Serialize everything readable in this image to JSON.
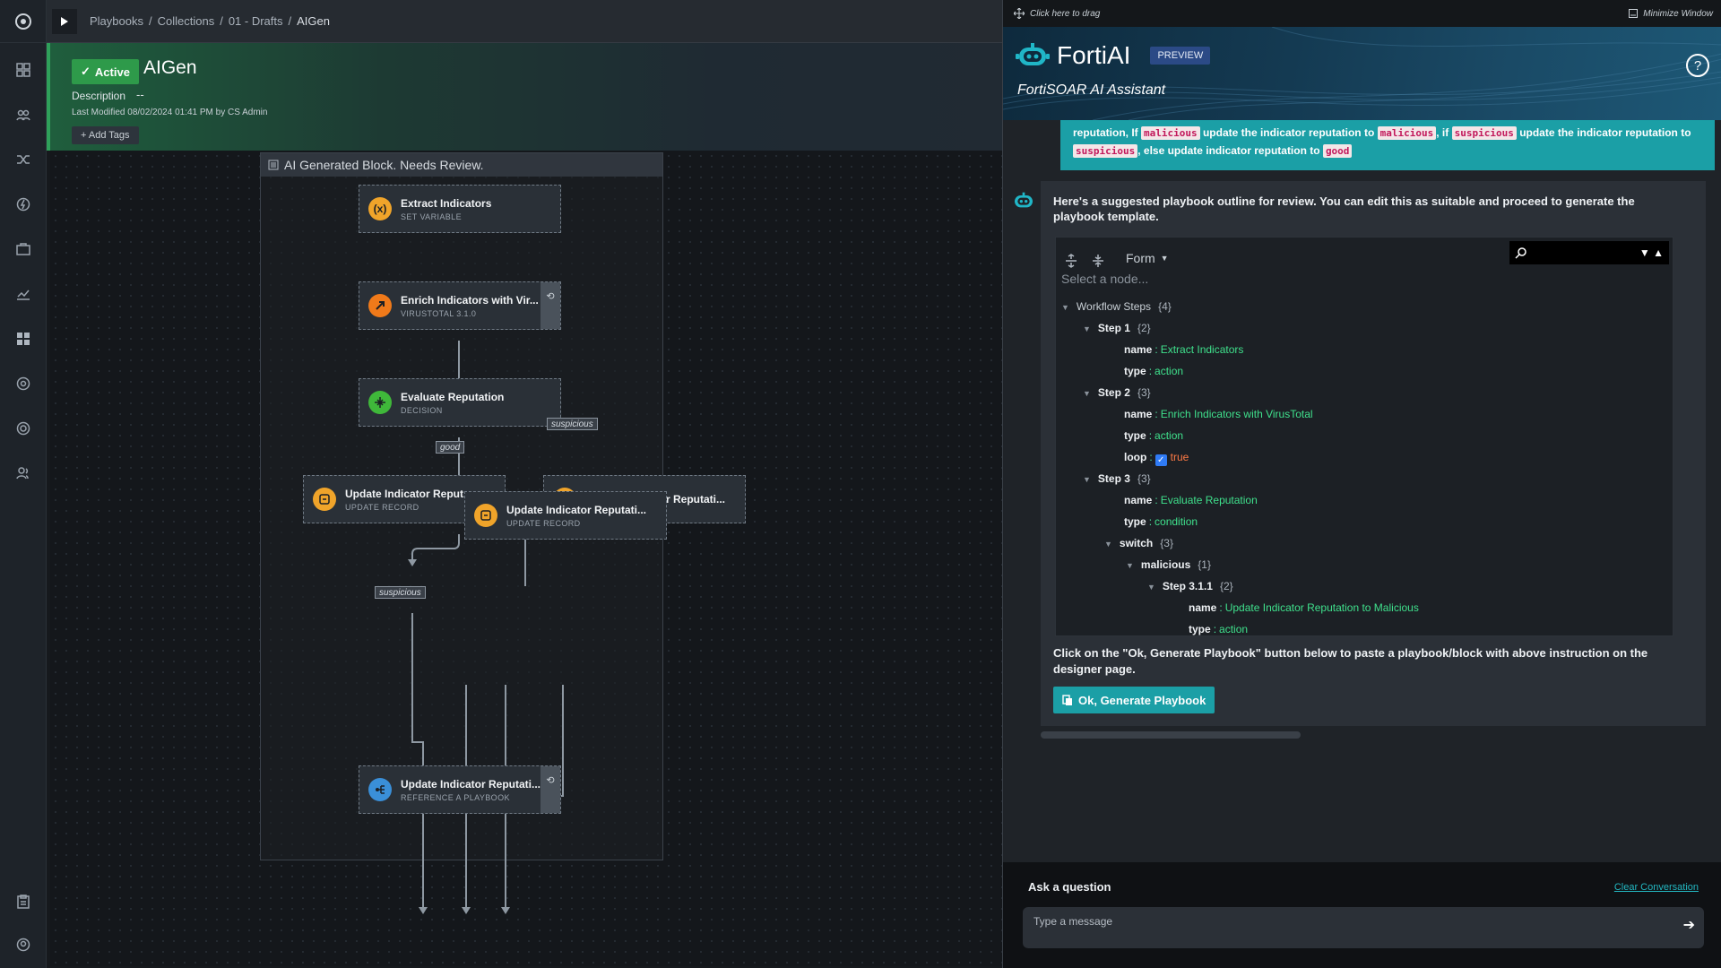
{
  "breadcrumb": {
    "items": [
      "Playbooks",
      "Collections",
      "01 - Drafts"
    ],
    "separator": "/",
    "current": "AIGen"
  },
  "playbook": {
    "status": "Active",
    "title": "AIGen",
    "description_label": "Description",
    "description_value": "--",
    "last_modified": "Last Modified 08/02/2024 01:41 PM by CS Admin",
    "add_tags": "+ Add Tags"
  },
  "canvas": {
    "block_title": "AI Generated Block. Needs Review.",
    "nodes": [
      {
        "title": "Extract Indicators",
        "subtitle": "SET VARIABLE",
        "icon": "variable-icon",
        "color": "#f0a42a"
      },
      {
        "title": "Enrich Indicators with Vir...",
        "subtitle": "VIRUSTOTAL 3.1.0",
        "icon": "connector-icon",
        "color": "#f07a1a"
      },
      {
        "title": "Evaluate Reputation",
        "subtitle": "DECISION",
        "icon": "decision-icon",
        "color": "#3fb83a"
      },
      {
        "title": "Update Indicator Reput...",
        "subtitle": "UPDATE RECORD",
        "icon": "update-record-icon",
        "color": "#f0a42a"
      },
      {
        "title": "Update Indicator Reputati...",
        "subtitle": "UPDATE RECORD",
        "icon": "update-record-icon",
        "color": "#f0a42a"
      },
      {
        "title": "Update Indicator Reputati...",
        "subtitle": "",
        "icon": "update-record-icon",
        "color": "#f0a42a"
      },
      {
        "title": "Update Indicator Reputati...",
        "subtitle": "REFERENCE A PLAYBOOK",
        "icon": "reference-playbook-icon",
        "color": "#3a8fd8"
      }
    ],
    "edge_labels": {
      "good": "good",
      "suspicious_top": "suspicious",
      "suspicious_mid": "suspicious"
    }
  },
  "assistant": {
    "drag_hint": "Click here to drag",
    "minimize": "Minimize Window",
    "name": "FortiAI",
    "preview": "PREVIEW",
    "subtitle": "FortiSOAR AI Assistant",
    "help": "?",
    "user_message": {
      "t1": "reputation, If",
      "kw1": "malicious",
      "t2": "update the indicator reputation to",
      "kw2": "malicious",
      "t3": ", if",
      "kw3": "suspicious",
      "t4": "update the indicator reputation to",
      "kw4": "suspicious",
      "t5": ", else update indicator reputation to",
      "kw5": "good"
    },
    "bot_message": "Here's a suggested playbook outline for review. You can edit this as suitable and proceed to generate the playbook template.",
    "tree": {
      "mode": "Form",
      "select_placeholder": "Select a node...",
      "root": {
        "key": "Workflow Steps",
        "count": "{4}"
      },
      "step1": {
        "key": "Step 1",
        "count": "{2}",
        "name": "Extract Indicators",
        "type": "action"
      },
      "step2": {
        "key": "Step 2",
        "count": "{3}",
        "name": "Enrich Indicators with VirusTotal",
        "type": "action",
        "loop": "true"
      },
      "step3": {
        "key": "Step 3",
        "count": "{3}",
        "name": "Evaluate Reputation",
        "type": "condition"
      },
      "switch": {
        "key": "switch",
        "count": "{3}"
      },
      "malicious": {
        "key": "malicious",
        "count": "{1}"
      },
      "step311": {
        "key": "Step 3.1.1",
        "count": "{2}",
        "name": "Update Indicator Reputation to Malicious",
        "type": "action"
      },
      "labels": {
        "name": "name",
        "type": "type",
        "loop": "loop",
        "colon": ":"
      }
    },
    "after_text": "Click on the \"Ok, Generate Playbook\" button below to paste a playbook/block with above instruction on the designer page.",
    "generate_button": "Ok, Generate Playbook",
    "ask_label": "Ask a question",
    "clear_conversation": "Clear Conversation",
    "input_placeholder": "Type a message"
  },
  "colors": {
    "accent": "#1b9fa6",
    "active_green": "#2e9a4a",
    "string_value": "#3fe08c",
    "bool_value": "#ff7a45"
  }
}
